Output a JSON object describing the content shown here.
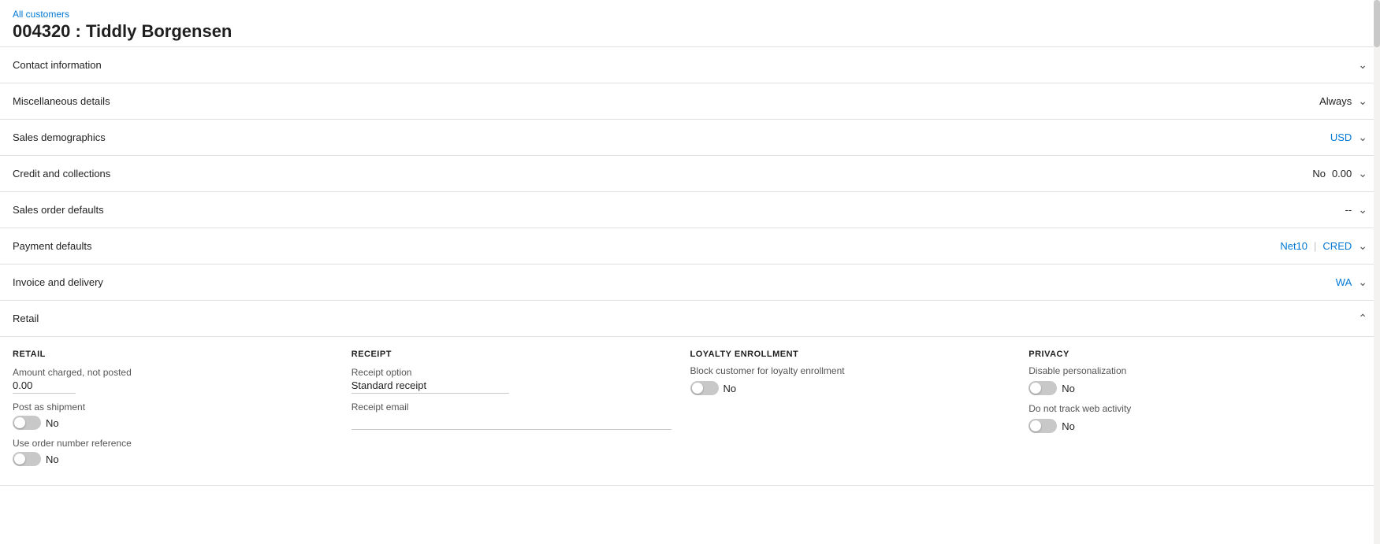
{
  "breadcrumb": {
    "label": "All customers",
    "url": "#"
  },
  "page": {
    "title": "004320 : Tiddly Borgensen"
  },
  "sections": [
    {
      "id": "contact-information",
      "label": "Contact information",
      "summary": "",
      "summary_link": "",
      "expanded": false,
      "chevron": "chevron-down"
    },
    {
      "id": "miscellaneous-details",
      "label": "Miscellaneous details",
      "summary": "Always",
      "summary_link": "",
      "expanded": false,
      "chevron": "chevron-down"
    },
    {
      "id": "sales-demographics",
      "label": "Sales demographics",
      "summary_link": "USD",
      "expanded": false,
      "chevron": "chevron-down"
    },
    {
      "id": "credit-and-collections",
      "label": "Credit and collections",
      "summary": "No",
      "summary2": "0.00",
      "expanded": false,
      "chevron": "chevron-down"
    },
    {
      "id": "sales-order-defaults",
      "label": "Sales order defaults",
      "summary": "--",
      "expanded": false,
      "chevron": "chevron-down"
    },
    {
      "id": "payment-defaults",
      "label": "Payment defaults",
      "summary_link1": "Net10",
      "summary_link2": "CRED",
      "expanded": false,
      "chevron": "chevron-down"
    },
    {
      "id": "invoice-and-delivery",
      "label": "Invoice and delivery",
      "summary_link": "WA",
      "expanded": false,
      "chevron": "chevron-down"
    }
  ],
  "retail": {
    "section_label": "Retail",
    "chevron": "chevron-up",
    "columns": {
      "retail": {
        "header": "RETAIL",
        "field_label": "Amount charged, not posted",
        "field_value": "0.00",
        "post_as_shipment_label": "Post as shipment",
        "post_as_shipment_value": "No",
        "use_order_number_label": "Use order number reference",
        "use_order_number_value": "No"
      },
      "receipt": {
        "header": "RECEIPT",
        "receipt_option_label": "Receipt option",
        "receipt_option_value": "Standard receipt",
        "receipt_email_label": "Receipt email"
      },
      "loyalty": {
        "header": "LOYALTY ENROLLMENT",
        "block_label": "Block customer for loyalty enrollment",
        "block_value": "No"
      },
      "privacy": {
        "header": "PRIVACY",
        "disable_label": "Disable personalization",
        "disable_value": "No",
        "no_track_label": "Do not track web activity",
        "no_track_value": "No"
      }
    }
  },
  "icons": {
    "chevron_down": "⌄",
    "chevron_up": "⌃"
  },
  "colors": {
    "link": "#0078d4",
    "border": "#e0e0e0",
    "toggle_off": "#c8c8c8"
  }
}
